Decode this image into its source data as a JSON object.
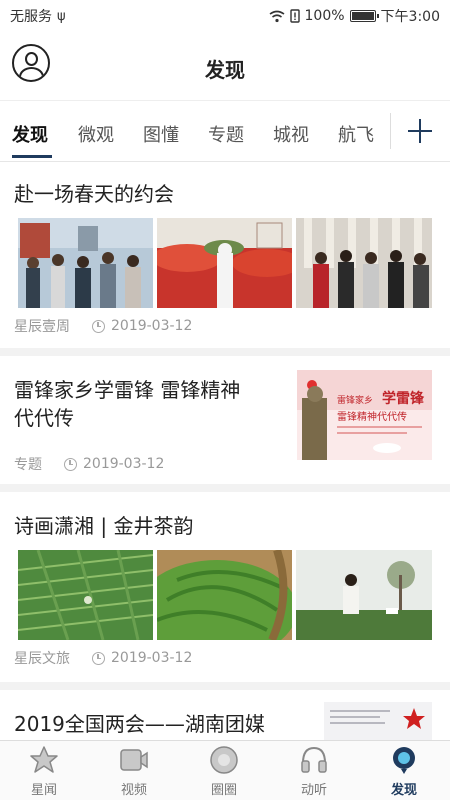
{
  "status_bar": {
    "carrier": "无服务",
    "battery": "100%",
    "time": "下午3:00"
  },
  "header": {
    "title": "发现"
  },
  "tabs": [
    "发现",
    "微观",
    "图懂",
    "专题",
    "城视",
    "航飞"
  ],
  "articles": [
    {
      "title": "赴一场春天的约会",
      "source": "星辰壹周",
      "date": "2019-03-12"
    },
    {
      "title_line1": "雷锋家乡学雷锋 雷锋精神",
      "title_line2": "代代传",
      "source": "专题",
      "date": "2019-03-12",
      "thumb_text1": "雷锋家乡",
      "thumb_text2": "学雷锋",
      "thumb_text3": "雷锋精神代代传"
    },
    {
      "title": "诗画潇湘 | 金井茶韵",
      "source": "星辰文旅",
      "date": "2019-03-12"
    },
    {
      "title": "2019全国两会——湖南团媒"
    }
  ],
  "tabbar": [
    {
      "label": "星闻",
      "icon": "star-icon"
    },
    {
      "label": "视频",
      "icon": "video-icon"
    },
    {
      "label": "圈圈",
      "icon": "circle-icon"
    },
    {
      "label": "动听",
      "icon": "headphones-icon"
    },
    {
      "label": "发现",
      "icon": "discover-icon"
    }
  ],
  "colors": {
    "accent": "#1f3b5e",
    "meta": "#999999"
  }
}
